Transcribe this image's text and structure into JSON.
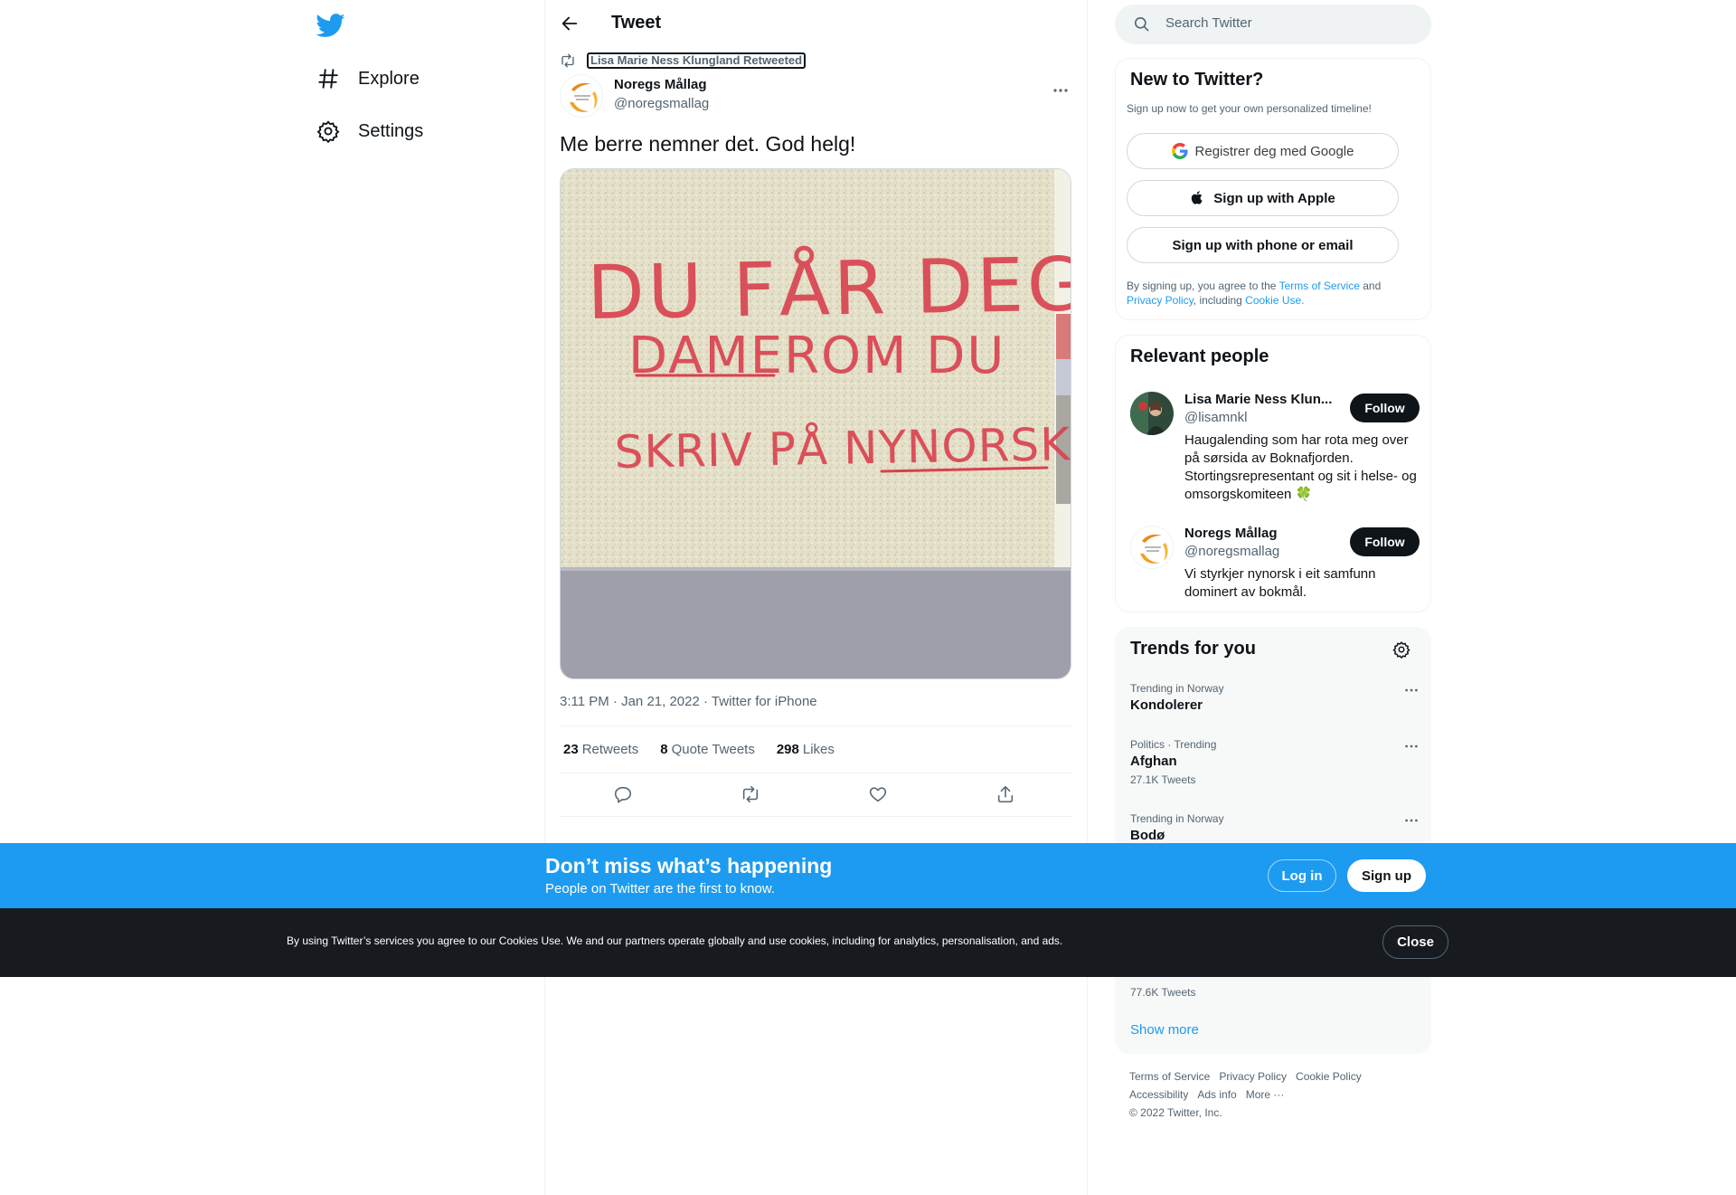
{
  "nav": {
    "explore": "Explore",
    "settings": "Settings"
  },
  "header": {
    "title": "Tweet"
  },
  "tweet": {
    "retweeted_by": "Lisa Marie Ness Klungland Retweeted",
    "author_name": "Noregs Mållag",
    "author_handle": "@noregsmallag",
    "text": "Me berre nemner det. God helg!",
    "image_lines": [
      "DU FÅR DEG",
      "DAMEROM DU",
      "SKRIV PÅ NYNORSK"
    ],
    "time": "3:11 PM",
    "date": "Jan 21, 2022",
    "source": "Twitter for iPhone",
    "retweets_count": "23",
    "retweets_label": "Retweets",
    "quotes_count": "8",
    "quotes_label": "Quote Tweets",
    "likes_count": "298",
    "likes_label": "Likes"
  },
  "search": {
    "placeholder": "Search Twitter"
  },
  "new_to_twitter": {
    "title": "New to Twitter?",
    "subtitle": "Sign up now to get your own personalized timeline!",
    "google": "Registrer deg med Google",
    "apple": "Sign up with Apple",
    "phone": "Sign up with phone or email",
    "legal_1": "By signing up, you agree to the ",
    "terms": "Terms of Service",
    "legal_2": " and ",
    "privacy": "Privacy Policy",
    "legal_3": ", including ",
    "cookie": "Cookie Use."
  },
  "relevant_people": {
    "title": "Relevant people",
    "people": [
      {
        "name": "Lisa Marie Ness Klun...",
        "handle": "@lisamnkl",
        "bio": "Haugalending som har rota meg over på sørsida av Boknafjorden. Stortingsrepresentant og sit i helse- og omsorgskomiteen 🍀",
        "follow": "Follow"
      },
      {
        "name": "Noregs Mållag",
        "handle": "@noregsmallag",
        "bio": "Vi styrkjer nynorsk i eit samfunn dominert av bokmål.",
        "follow": "Follow"
      }
    ]
  },
  "trends": {
    "title": "Trends for you",
    "items": [
      {
        "context": "Trending in Norway",
        "name": "Kondolerer",
        "count": ""
      },
      {
        "context": "Politics · Trending",
        "name": "Afghan",
        "count": "27.1K Tweets"
      },
      {
        "context": "Trending in Norway",
        "name": "Bodø",
        "count": ""
      }
    ],
    "hidden_count": "77.6K Tweets",
    "show_more": "Show more"
  },
  "footer": {
    "terms": "Terms of Service",
    "privacy": "Privacy Policy",
    "cookie": "Cookie Policy",
    "accessibility": "Accessibility",
    "ads": "Ads info",
    "more": "More ···",
    "copyright": "© 2022 Twitter, Inc."
  },
  "banner": {
    "title": "Don’t miss what’s happening",
    "subtitle": "People on Twitter are the first to know.",
    "login": "Log in",
    "signup": "Sign up"
  },
  "cookie_bar": {
    "text": "By using Twitter’s services you agree to our Cookies Use. We and our partners operate globally and use cookies, including for analytics, personalisation, and ads.",
    "close": "Close"
  },
  "colors": {
    "brand": "#1d9bf0",
    "text": "#0f1419",
    "muted": "#536471",
    "cookie_bg": "#171b1f"
  }
}
